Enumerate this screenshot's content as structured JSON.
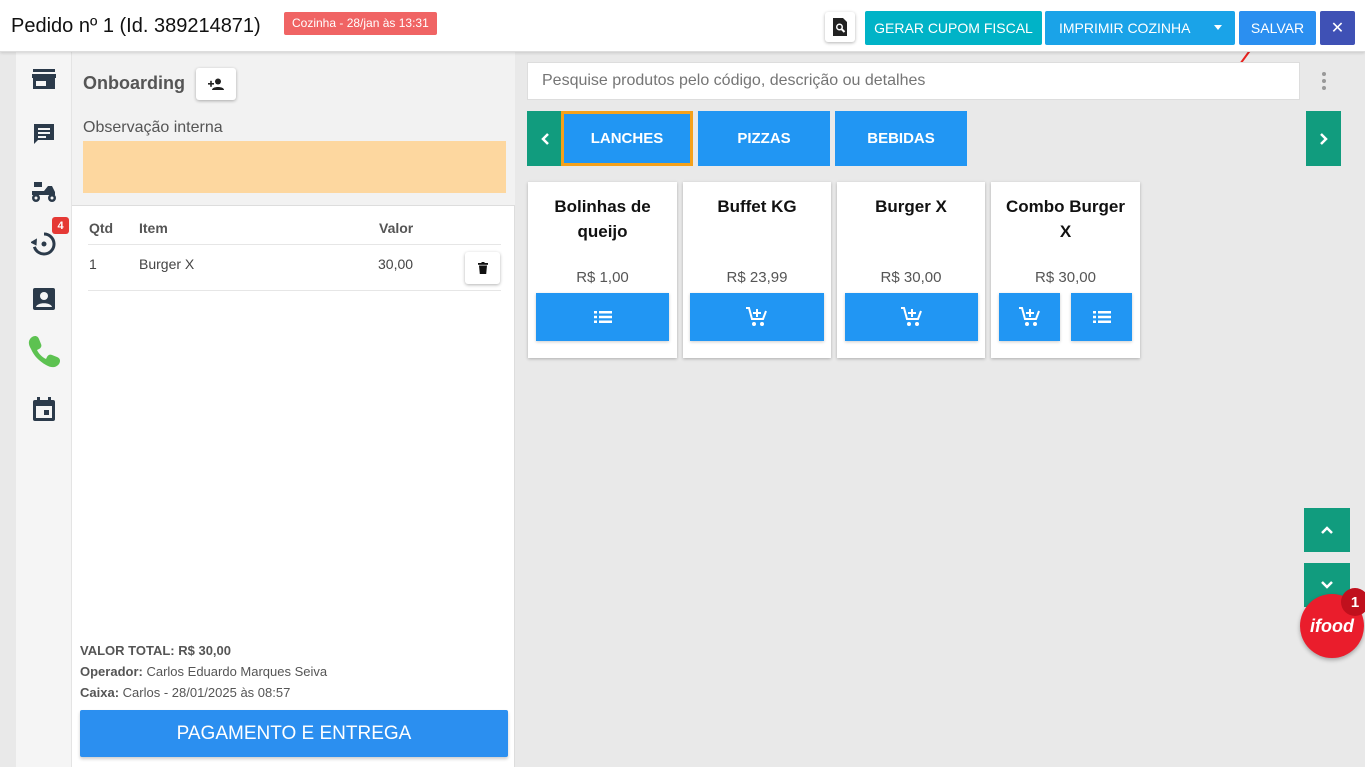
{
  "header": {
    "title": "Pedido nº 1 (Id. 389214871)",
    "kitchen_badge": "Cozinha - 28/jan às 13:31",
    "btn_fiscal": "GERAR CUPOM FISCAL",
    "btn_kitchen": "IMPRIMIR COZINHA",
    "btn_save": "SALVAR",
    "btn_close": "✕"
  },
  "rail": {
    "badge_count": "4"
  },
  "order": {
    "customer": "Onboarding",
    "obs_label": "Observação interna",
    "columns": {
      "qty": "Qtd",
      "item": "Item",
      "value": "Valor"
    },
    "items": [
      {
        "qty": "1",
        "name": "Burger X",
        "value": "30,00"
      }
    ],
    "total_label": "VALOR TOTAL:",
    "total_value": "R$ 30,00",
    "operator_label": "Operador:",
    "operator_value": "Carlos Eduardo Marques Seiva",
    "cashier_label": "Caixa:",
    "cashier_value": "Carlos - 28/01/2025 às 08:57",
    "pay_button": "PAGAMENTO E ENTREGA"
  },
  "search": {
    "placeholder": "Pesquise produtos pelo código, descrição ou detalhes"
  },
  "categories": [
    "LANCHES",
    "PIZZAS",
    "BEBIDAS"
  ],
  "products": [
    {
      "name": "Bolinhas de queijo",
      "price": "R$ 1,00"
    },
    {
      "name": "Buffet KG",
      "price": "R$ 23,99"
    },
    {
      "name": "Burger X",
      "price": "R$ 30,00"
    },
    {
      "name": "Combo Burger X",
      "price": "R$ 30,00"
    }
  ],
  "ifood": {
    "label": "ifood",
    "badge": "1"
  },
  "colors": {
    "primary": "#2196f3",
    "teal": "#119c7e",
    "fiscal": "#00b3c7",
    "close": "#3f51b5",
    "observation": "#fdd79f",
    "kitchen_badge": "#f06464",
    "ifood": "#ea1d2c",
    "active_category_border": "#f5a11a"
  }
}
